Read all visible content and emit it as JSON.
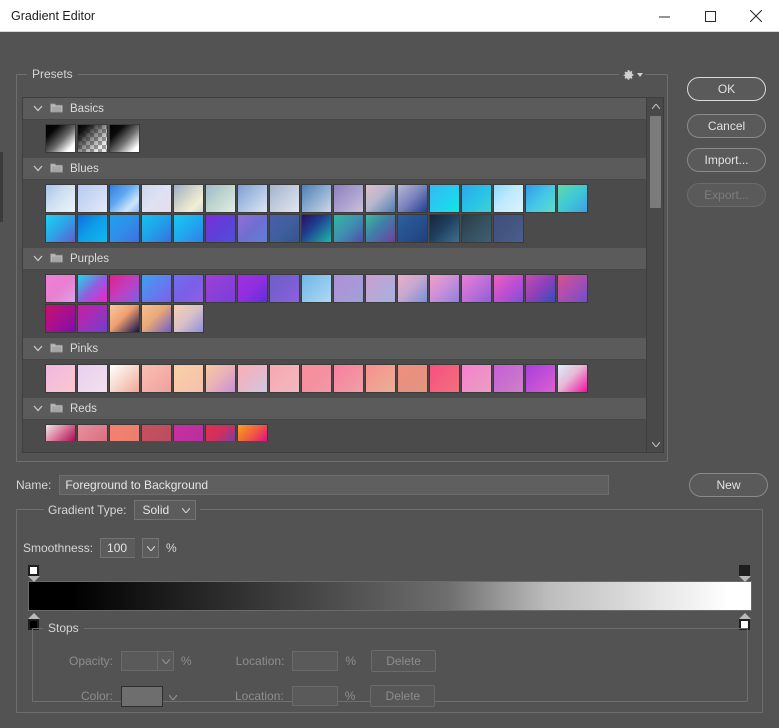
{
  "window": {
    "title": "Gradient Editor",
    "controls": [
      {
        "name": "minimize",
        "glyph": "minimize-icon"
      },
      {
        "name": "maximize",
        "glyph": "maximize-icon"
      },
      {
        "name": "close",
        "glyph": "close-icon"
      }
    ]
  },
  "presets": {
    "label": "Presets",
    "menu_icon": "gear-icon",
    "folders": [
      {
        "name": "Basics",
        "expanded": true,
        "chevron": "chevron-down-icon",
        "icon": "folder-icon",
        "rows": [
          [
            {
              "css": "linear-gradient(135deg,#000 0%,#050505 22%,#6a6a6a 55%,#ffffff 85%)"
            },
            {
              "css": "linear-gradient(135deg,#000 0%,#111 18%,rgba(40,40,40,0.55) 45%,rgba(255,255,255,0) 80%)",
              "checker": true
            },
            {
              "css": "linear-gradient(135deg,#000 0%,#0a0a0a 25%,#777 58%,#ffffff 88%)"
            }
          ]
        ]
      },
      {
        "name": "Blues",
        "expanded": true,
        "chevron": "chevron-down-icon",
        "icon": "folder-icon",
        "rows": [
          [
            {
              "css": "linear-gradient(135deg,#a8c4e8 0%,#cfe0f2 45%,#eef4fb 100%)"
            },
            {
              "css": "linear-gradient(135deg,#b6cbf2 0%,#cbd9f4 50%,#e6e9f7 100%)"
            },
            {
              "css": "linear-gradient(135deg,#2f7fe0 0%,#5fa8f0 40%,#cfe4fb 75%,#8bb8ef 100%)"
            },
            {
              "css": "linear-gradient(135deg,#cdd6ef 0%,#dee2f2 50%,#e8dcee 100%)"
            },
            {
              "css": "linear-gradient(135deg,#9fadc4 0%,#d4d6c9 45%,#f2efd3 75%,#cfd4de 100%)"
            },
            {
              "css": "linear-gradient(135deg,#9fb8c9 0%,#bcd3cf 45%,#dfeee4 100%)"
            },
            {
              "css": "linear-gradient(135deg,#7f9fd0 0%,#a8c0e2 45%,#dfe6f2 100%)"
            },
            {
              "css": "linear-gradient(135deg,#a4b3cc 0%,#c3cddf 50%,#e1e6ef 100%)"
            },
            {
              "css": "linear-gradient(135deg,#4f7fb5 0%,#86a8cd 45%,#ccd8e6 100%)"
            },
            {
              "css": "linear-gradient(135deg,#8e7fc0 0%,#a79ccd 45%,#c8c0e0 100%)"
            },
            {
              "css": "linear-gradient(135deg,#dcbfc6 0%,#b8b7cf 45%,#4d7fae 100%)"
            },
            {
              "css": "linear-gradient(135deg,#b6b8d6 0%,#7a82bc 50%,#1f3f8f 100%)"
            },
            {
              "css": "linear-gradient(135deg,#35b8f2 0%,#22d0f0 55%,#0fe8e0 100%)"
            },
            {
              "css": "linear-gradient(135deg,#2fa6ea 0%,#27c2e8 50%,#3fd2d0 100%)"
            },
            {
              "css": "linear-gradient(135deg,#8fd9fb 0%,#bfeafd 45%,#d9f2fe 100%)"
            },
            {
              "css": "linear-gradient(135deg,#2f9ae8 0%,#45c6e6 50%,#5fdcc8 100%)"
            },
            {
              "css": "linear-gradient(135deg,#5fd8a8 0%,#3fc9d6 50%,#3f9fe0 100%)"
            }
          ],
          [
            {
              "css": "linear-gradient(135deg,#1fd0f2 0%,#29a8e8 45%,#5f5fd0 100%)"
            },
            {
              "css": "linear-gradient(135deg,#0f6fe0 0%,#0f9fe8 50%,#10b8f2 100%)"
            },
            {
              "css": "linear-gradient(135deg,#1f9ff0 0%,#2f8fe8 50%,#3f6fe0 100%)"
            },
            {
              "css": "linear-gradient(135deg,#14c4f0 0%,#1f9fe8 50%,#3a6fe2 100%)"
            },
            {
              "css": "linear-gradient(135deg,#18c8f2 0%,#1fa8ee 50%,#2f7fe8 100%)"
            },
            {
              "css": "linear-gradient(135deg,#7a2fd8 0%,#5f3fd8 50%,#4f4fd8 100%)"
            },
            {
              "css": "linear-gradient(135deg,#8f6fd8 0%,#6f6fd0 50%,#5f7fd8 100%)"
            },
            {
              "css": "linear-gradient(135deg,#4a5fa8 0%,#3f5f9f 50%,#36538f 100%)"
            },
            {
              "css": "linear-gradient(135deg,#2a0f5f 0%,#1f3f8f 40%,#1fb8a8 100%)"
            },
            {
              "css": "linear-gradient(135deg,#2fb8a0 0%,#3f8fb0 50%,#4f4fa8 100%)"
            },
            {
              "css": "linear-gradient(135deg,#3fb8a0 0%,#3f7fa8 45%,#6f3f9f 100%)"
            },
            {
              "css": "linear-gradient(135deg,#2f5f9f 0%,#27508f 50%,#1f3f7f 100%)"
            },
            {
              "css": "linear-gradient(135deg,#16263a 0%,#1f3f5f 45%,#3f6f8f 100%)"
            },
            {
              "css": "linear-gradient(135deg,#2a3a46 0%,#34505f 50%,#3f5f6f 100%)"
            },
            {
              "css": "linear-gradient(135deg,#3f4f7f 0%,#44557f 50%,#4a5f8f 100%)"
            }
          ]
        ]
      },
      {
        "name": "Purples",
        "expanded": true,
        "chevron": "chevron-down-icon",
        "icon": "folder-icon",
        "rows": [
          [
            {
              "css": "linear-gradient(135deg,#f07fd8 0%,#e87fd0 50%,#e0a0e8 100%)"
            },
            {
              "css": "linear-gradient(135deg,#1fd8e8 0%,#8f5fe0 50%,#f020c8 100%)"
            },
            {
              "css": "linear-gradient(135deg,#e01f8f 0%,#c03fc0 50%,#7a5fe8 100%)"
            },
            {
              "css": "linear-gradient(135deg,#3f9ff0 0%,#5f7fee 50%,#7f5fe8 100%)"
            },
            {
              "css": "linear-gradient(135deg,#6f6fee 0%,#7a5fe8 50%,#8f5fe8 100%)"
            },
            {
              "css": "linear-gradient(135deg,#9f3fd8 0%,#8a3fd8 50%,#7a3fd8 100%)"
            },
            {
              "css": "linear-gradient(135deg,#a02fe0 0%,#8f2fe0 50%,#5f2fd8 100%)"
            },
            {
              "css": "linear-gradient(135deg,#6f5fc8 0%,#7a5fd0 50%,#8f5fe0 100%)"
            },
            {
              "css": "linear-gradient(135deg,#6fb8e8 0%,#8fc8ee 50%,#afd8f2 100%)"
            },
            {
              "css": "linear-gradient(135deg,#b090d8 0%,#a898d8 50%,#a0a0d8 100%)"
            },
            {
              "css": "linear-gradient(135deg,#c89fd0 0%,#b8a8d8 50%,#a8b0e0 100%)"
            },
            {
              "css": "linear-gradient(135deg,#e8b0c8 0%,#c8a8d0 45%,#7a8fd8 100%)"
            },
            {
              "css": "linear-gradient(135deg,#f09fc8 0%,#c88fd8 50%,#8f7fe0 100%)"
            },
            {
              "css": "linear-gradient(135deg,#e87fd8 0%,#c06fd8 50%,#8f5fd8 100%)"
            },
            {
              "css": "linear-gradient(135deg,#f05fc0 0%,#c04fd0 50%,#7f4fd8 100%)"
            },
            {
              "css": "linear-gradient(135deg,#c04fb0 0%,#8f3fb8 50%,#2f4fc0 100%)"
            },
            {
              "css": "linear-gradient(135deg,#d8508f 0%,#a84fb0 50%,#6f4fc8 100%)"
            }
          ],
          [
            {
              "css": "linear-gradient(135deg,#c8106f 0%,#a8108f 50%,#7a10a8 100%)"
            },
            {
              "css": "linear-gradient(135deg,#c81f9f 0%,#9f2fb8 50%,#6f3fd0 100%)"
            },
            {
              "css": "linear-gradient(135deg,#f8c8a0 0%,#f0a070 45%,#10104f 100%)"
            },
            {
              "css": "linear-gradient(135deg,#f8c090 0%,#e8a878 45%,#6f5fc8 100%)"
            },
            {
              "css": "linear-gradient(135deg,#f8d0b0 0%,#d8c0c8 50%,#8f8fd8 100%)"
            }
          ]
        ]
      },
      {
        "name": "Pinks",
        "expanded": true,
        "chevron": "chevron-down-icon",
        "icon": "folder-icon",
        "rows": [
          [
            {
              "css": "linear-gradient(135deg,#f0b8e0 0%,#f5c0d8 50%,#f8c8d0 100%)"
            },
            {
              "css": "linear-gradient(135deg,#e8d0ee 0%,#eed8ee 50%,#f2e0ee 100%)"
            },
            {
              "css": "linear-gradient(135deg,#ffffff 0%,#f8dcd0 45%,#f0a898 100%)"
            },
            {
              "css": "linear-gradient(135deg,#f8c0b0 0%,#f5b0a8 50%,#f0a0a0 100%)"
            },
            {
              "css": "linear-gradient(135deg,#f8d0a8 0%,#f8c8a8 50%,#f5c0b0 100%)"
            },
            {
              "css": "linear-gradient(135deg,#f8c89f 0%,#e8b0b8 50%,#c890d8 100%)"
            },
            {
              "css": "linear-gradient(135deg,#f8b0b8 0%,#e8b8c8 50%,#d0c8e0 100%)"
            },
            {
              "css": "linear-gradient(135deg,#f8a8b0 0%,#f5b0b8 50%,#f0b8c0 100%)"
            },
            {
              "css": "linear-gradient(135deg,#f88f9f 0%,#f5909f 50%,#f098a8 100%)"
            },
            {
              "css": "linear-gradient(135deg,#f87f9f 0%,#f58fa0 50%,#f09fa8 100%)"
            },
            {
              "css": "linear-gradient(135deg,#f88f8f 0%,#f0a090 50%,#e8b098 100%)"
            },
            {
              "css": "linear-gradient(135deg,#f08f7f 0%,#e8907f 50%,#e09880 100%)"
            },
            {
              "css": "linear-gradient(135deg,#f84f7f 0%,#f5607f 50%,#f07080 100%)"
            },
            {
              "css": "linear-gradient(135deg,#f87fd0 0%,#f08fc8 50%,#e89fc0 100%)"
            },
            {
              "css": "linear-gradient(135deg,#c85fd8 0%,#c86fd0 50%,#d07fc8 100%)"
            },
            {
              "css": "linear-gradient(135deg,#a83fd8 0%,#c04fd8 50%,#e05fd0 100%)"
            },
            {
              "css": "linear-gradient(135deg,#d8eefb 0%,#e8b8d8 45%,#f010a0 100%)"
            }
          ]
        ]
      },
      {
        "name": "Reds",
        "expanded": true,
        "chevron": "chevron-down-icon",
        "icon": "folder-icon",
        "rows": [
          [
            {
              "css": "linear-gradient(135deg,#e8e8e8 0%,#e080a0 45%,#a81050 100%)",
              "clip": true
            },
            {
              "css": "linear-gradient(135deg,#e8909f 0%,#e0808f 50%,#d87080 100%)",
              "clip": true
            },
            {
              "css": "linear-gradient(135deg,#f87f6f 0%,#f08070 50%,#e88070 100%)",
              "clip": true
            },
            {
              "css": "linear-gradient(135deg,#c84f5f 0%,#c04f5f 50%,#b84f5f 100%)",
              "clip": true
            },
            {
              "css": "linear-gradient(135deg,#c82fa0 0%,#c02f9f 50%,#b82f9f 100%)",
              "clip": true
            },
            {
              "css": "linear-gradient(135deg,#e02f4f 0%,#d02f5f 50%,#7a3f9f 100%)",
              "clip": true
            },
            {
              "css": "linear-gradient(135deg,#f8a020 0%,#f0603f 50%,#e0107f 100%)",
              "clip": true
            }
          ]
        ]
      }
    ],
    "scrollbar": {
      "up_icon": "chevron-up-icon",
      "down_icon": "chevron-down-icon"
    }
  },
  "buttons": {
    "ok": "OK",
    "cancel": "Cancel",
    "import": "Import...",
    "export": "Export...",
    "new": "New"
  },
  "name_field": {
    "label": "Name:",
    "value": "Foreground to Background"
  },
  "gradient": {
    "type_label": "Gradient Type:",
    "type_value": "Solid",
    "smoothness_label": "Smoothness:",
    "smoothness_value": "100",
    "percent": "%",
    "strip_css": "linear-gradient(to right,#000000 0%,#000000 6%,#6e6e6e 58%,#bdbdbd 72%,#ffffff 97%,#ffffff 100%)",
    "opacity_stops": [
      {
        "position": 0,
        "fill": "#ffffff"
      },
      {
        "position": 100,
        "fill": "#1e1e1e"
      }
    ],
    "color_stops": [
      {
        "position": 0,
        "fill": "#000000"
      },
      {
        "position": 100,
        "fill": "#ffffff"
      }
    ]
  },
  "stops": {
    "label": "Stops",
    "opacity_label": "Opacity:",
    "opacity_value": "",
    "color_label": "Color:",
    "location_label": "Location:",
    "location_value": "",
    "percent": "%",
    "delete_label": "Delete",
    "disabled": true
  }
}
